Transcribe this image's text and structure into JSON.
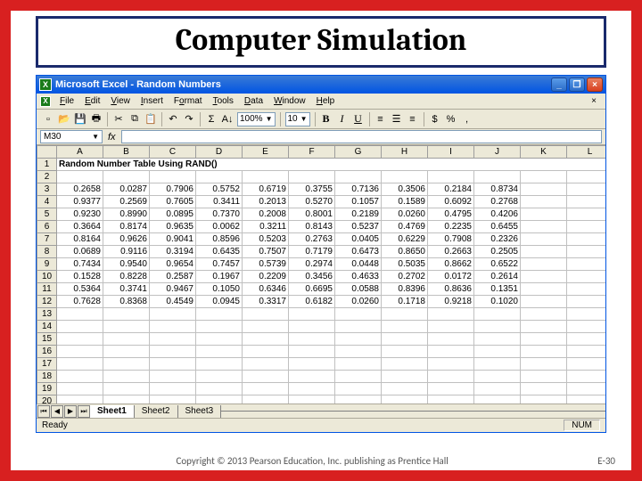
{
  "slide": {
    "title": "Computer Simulation",
    "copyright": "Copyright © 2013 Pearson Education, Inc. publishing as Prentice Hall",
    "page_number": "E-30"
  },
  "window": {
    "title": "Microsoft Excel - Random Numbers",
    "min": "_",
    "restore": "❐",
    "close": "×"
  },
  "menu": {
    "file": "File",
    "edit": "Edit",
    "view": "View",
    "insert": "Insert",
    "format": "Format",
    "tools": "Tools",
    "data": "Data",
    "window": "Window",
    "help": "Help"
  },
  "toolbar": {
    "zoom": "100%",
    "font_size": "10",
    "sigma": "Σ",
    "bold": "B",
    "italic": "I",
    "underline": "U",
    "currency": "$",
    "percent": "%",
    "comma": ","
  },
  "formula_bar": {
    "cell_ref": "M30",
    "fx": "fx"
  },
  "columns": [
    "A",
    "B",
    "C",
    "D",
    "E",
    "F",
    "G",
    "H",
    "I",
    "J",
    "K",
    "L"
  ],
  "header_row": "Random Number Table Using RAND()",
  "rows": [
    [
      "0.2658",
      "0.0287",
      "0.7906",
      "0.5752",
      "0.6719",
      "0.3755",
      "0.7136",
      "0.3506",
      "0.2184",
      "0.8734"
    ],
    [
      "0.9377",
      "0.2569",
      "0.7605",
      "0.3411",
      "0.2013",
      "0.5270",
      "0.1057",
      "0.1589",
      "0.6092",
      "0.2768"
    ],
    [
      "0.9230",
      "0.8990",
      "0.0895",
      "0.7370",
      "0.2008",
      "0.8001",
      "0.2189",
      "0.0260",
      "0.4795",
      "0.4206"
    ],
    [
      "0.3664",
      "0.8174",
      "0.9635",
      "0.0062",
      "0.3211",
      "0.8143",
      "0.5237",
      "0.4769",
      "0.2235",
      "0.6455"
    ],
    [
      "0.8164",
      "0.9626",
      "0.9041",
      "0.8596",
      "0.5203",
      "0.2763",
      "0.0405",
      "0.6229",
      "0.7908",
      "0.2326"
    ],
    [
      "0.0689",
      "0.9116",
      "0.3194",
      "0.6435",
      "0.7507",
      "0.7179",
      "0.6473",
      "0.8650",
      "0.2663",
      "0.2505"
    ],
    [
      "0.7434",
      "0.9540",
      "0.9654",
      "0.7457",
      "0.5739",
      "0.2974",
      "0.0448",
      "0.5035",
      "0.8662",
      "0.6522"
    ],
    [
      "0.1528",
      "0.8228",
      "0.2587",
      "0.1967",
      "0.2209",
      "0.3456",
      "0.4633",
      "0.2702",
      "0.0172",
      "0.2614"
    ],
    [
      "0.5364",
      "0.3741",
      "0.9467",
      "0.1050",
      "0.6346",
      "0.6695",
      "0.0588",
      "0.8396",
      "0.8636",
      "0.1351"
    ],
    [
      "0.7628",
      "0.8368",
      "0.4549",
      "0.0945",
      "0.3317",
      "0.6182",
      "0.0260",
      "0.1718",
      "0.9218",
      "0.1020"
    ]
  ],
  "sheet_tabs": {
    "s1": "Sheet1",
    "s2": "Sheet2",
    "s3": "Sheet3"
  },
  "status": {
    "ready": "Ready",
    "num": "NUM"
  }
}
